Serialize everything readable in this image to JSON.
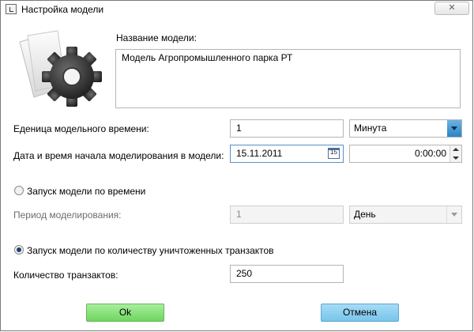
{
  "window": {
    "title": "Настройка модели"
  },
  "model_name": {
    "label": "Название модели:",
    "value": "Модель Агропромышленного парка РТ"
  },
  "time_unit": {
    "label": "Еденица модельного времени:",
    "value": "1",
    "unit": "Минута"
  },
  "start": {
    "label": "Дата и время начала моделирования в модели:",
    "date": "15.11.2011",
    "calendar_day": "15",
    "time": "0:00:00"
  },
  "time_mode": {
    "label": "Запуск модели по времени",
    "selected": false
  },
  "period": {
    "label": "Период моделирования:",
    "value": "1",
    "unit": "День"
  },
  "trans_mode": {
    "label": "Запуск модели по количеству уничтоженных транзактов",
    "selected": true
  },
  "trans_count": {
    "label": "Количество транзактов:",
    "value": "250"
  },
  "buttons": {
    "ok": "Ok",
    "cancel": "Отмена"
  },
  "colors": {
    "accent": "#2a83c6",
    "ok": "#6fd55f",
    "cancel": "#79c4ec"
  }
}
